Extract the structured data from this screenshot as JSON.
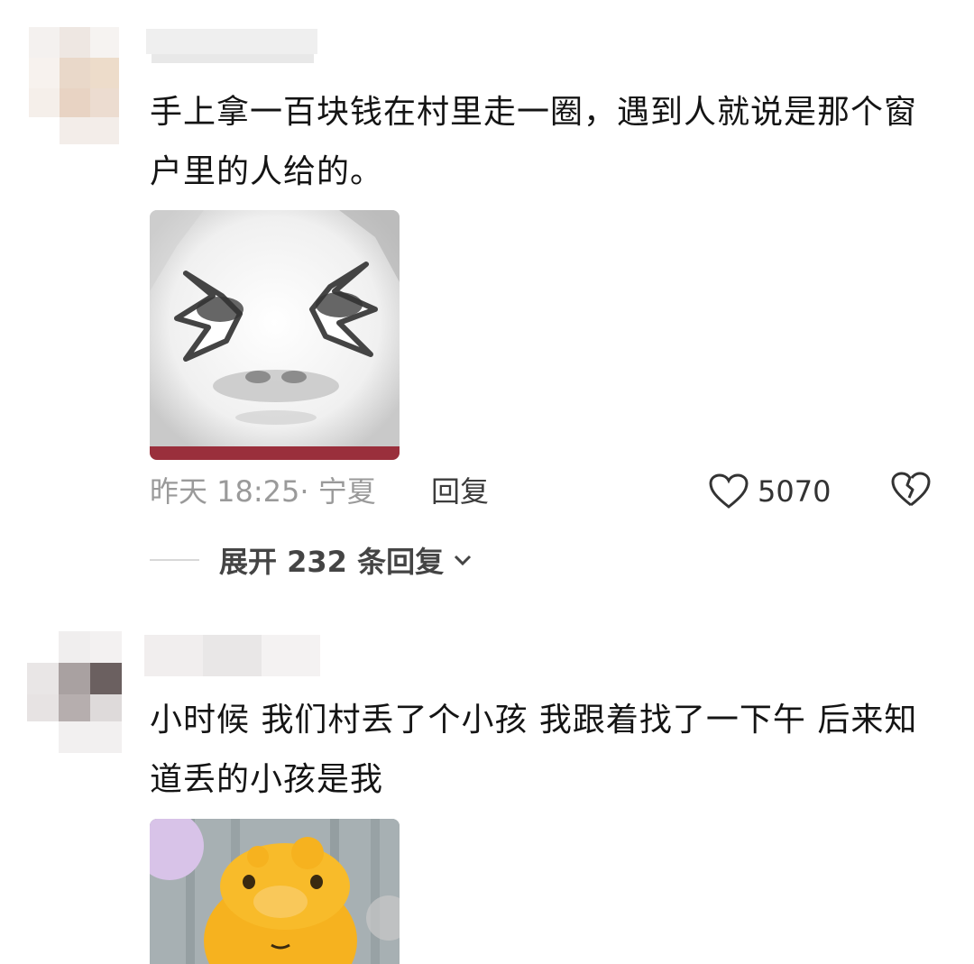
{
  "comments": [
    {
      "text": "手上拿一百块钱在村里走一圈，遇到人就说是那个窗户里的人给的。",
      "time_location": "昨天 18:25· 宁夏",
      "reply_label": "回复",
      "likes": "5070",
      "expand_label": "展开 232 条回复"
    },
    {
      "text": "小时候 我们村丢了个小孩 我跟着找了一下午 后来知道丢的小孩是我"
    }
  ],
  "icons": {
    "like": "heart-outline-icon",
    "dislike": "broken-heart-icon",
    "expand": "chevron-down-icon"
  },
  "colors": {
    "meta": "#9a9a9a",
    "text": "#141414"
  }
}
